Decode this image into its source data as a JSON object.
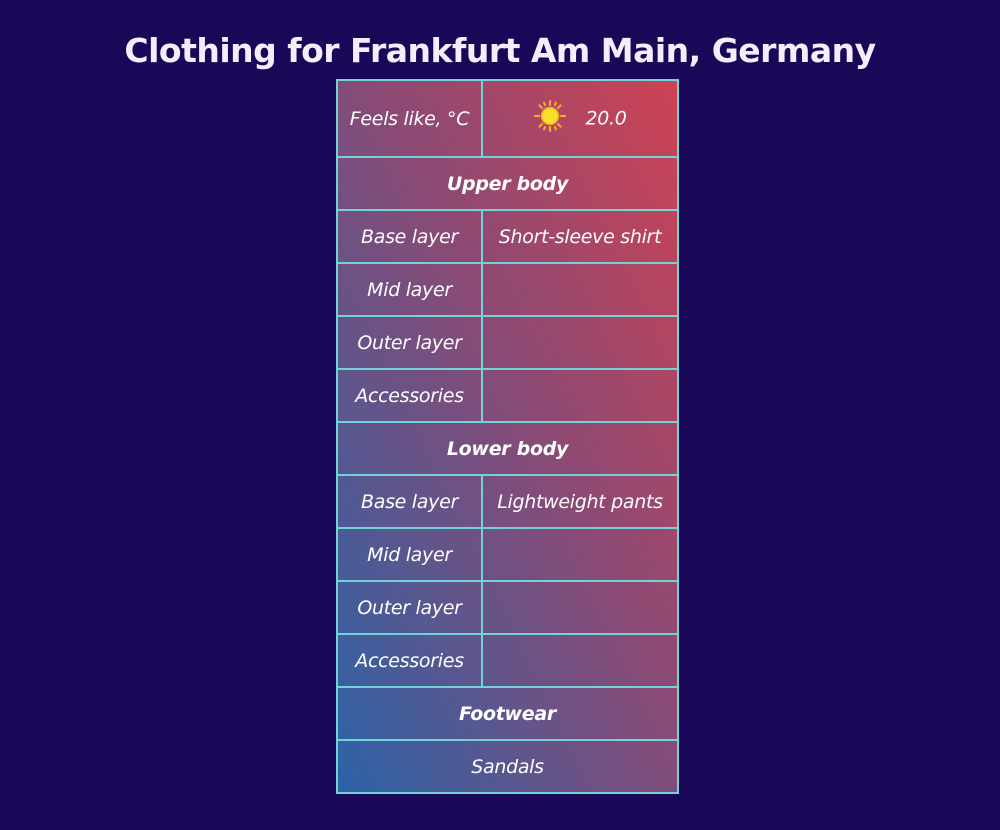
{
  "title": "Clothing for Frankfurt Am Main, Germany",
  "feels_like": {
    "label": "Feels like, °C",
    "icon": "sun-icon",
    "value": "20.0"
  },
  "upper_body": {
    "heading": "Upper body",
    "rows": [
      {
        "label": "Base layer",
        "value": "Short-sleeve shirt"
      },
      {
        "label": "Mid layer",
        "value": ""
      },
      {
        "label": "Outer layer",
        "value": ""
      },
      {
        "label": "Accessories",
        "value": ""
      }
    ]
  },
  "lower_body": {
    "heading": "Lower body",
    "rows": [
      {
        "label": "Base layer",
        "value": "Lightweight pants"
      },
      {
        "label": "Mid layer",
        "value": ""
      },
      {
        "label": "Outer layer",
        "value": ""
      },
      {
        "label": "Accessories",
        "value": ""
      }
    ]
  },
  "footwear": {
    "heading": "Footwear",
    "value": "Sandals"
  }
}
